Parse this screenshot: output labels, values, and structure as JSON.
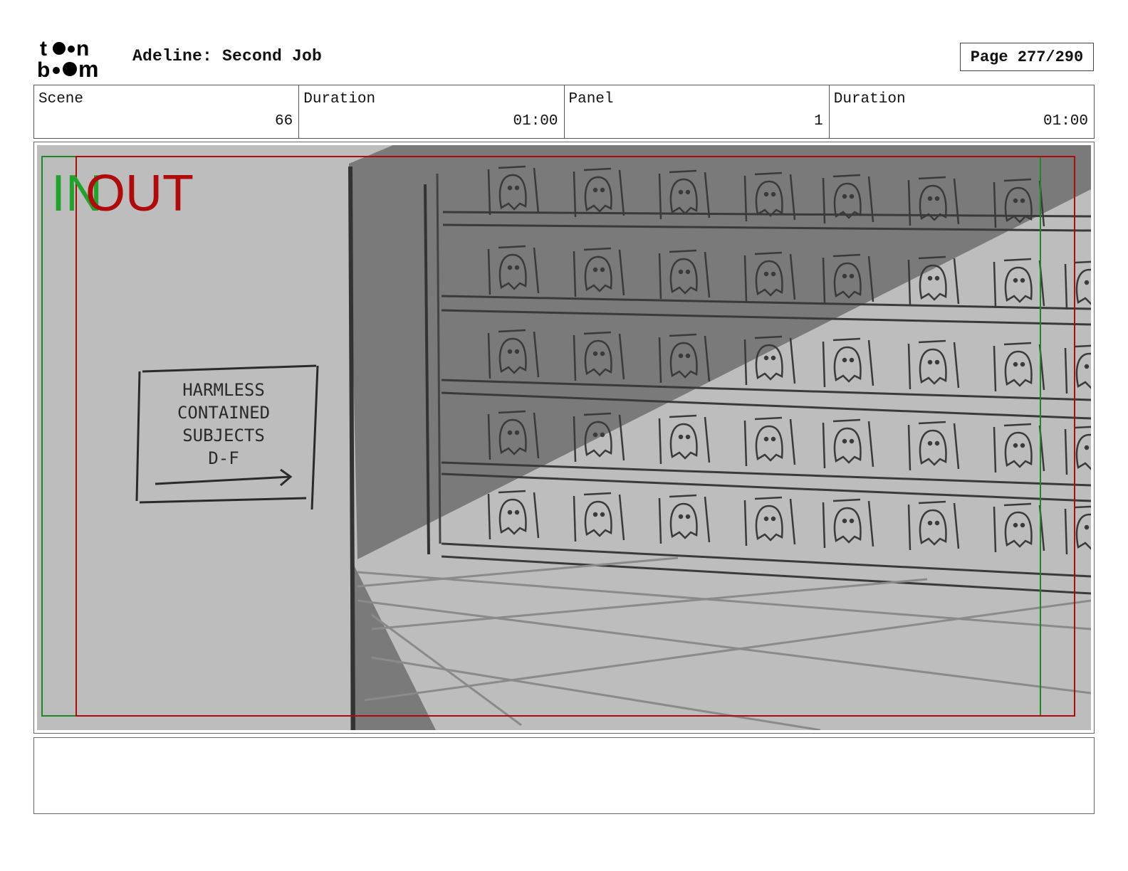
{
  "header": {
    "logo_text": "toon boom",
    "project_title": "Adeline: Second Job",
    "page_label": "Page 277/290"
  },
  "info": {
    "scene_label": "Scene",
    "scene_value": "66",
    "duration_label": "Duration",
    "duration_value": "01:00",
    "panel_label": "Panel",
    "panel_value": "1",
    "panel_duration_label": "Duration",
    "panel_duration_value": "01:00"
  },
  "frame": {
    "in_label": "IN",
    "out_label": "OUT",
    "sign_lines": [
      "HARMLESS",
      "CONTAINED",
      "SUBJECTS",
      "D-F"
    ]
  },
  "notes": {
    "text": ""
  },
  "colors": {
    "in_guide": "#1fa32a",
    "out_guide": "#b00a0a",
    "sketch_bg": "#bdbdbd",
    "shadow": "#7a7a7a"
  }
}
